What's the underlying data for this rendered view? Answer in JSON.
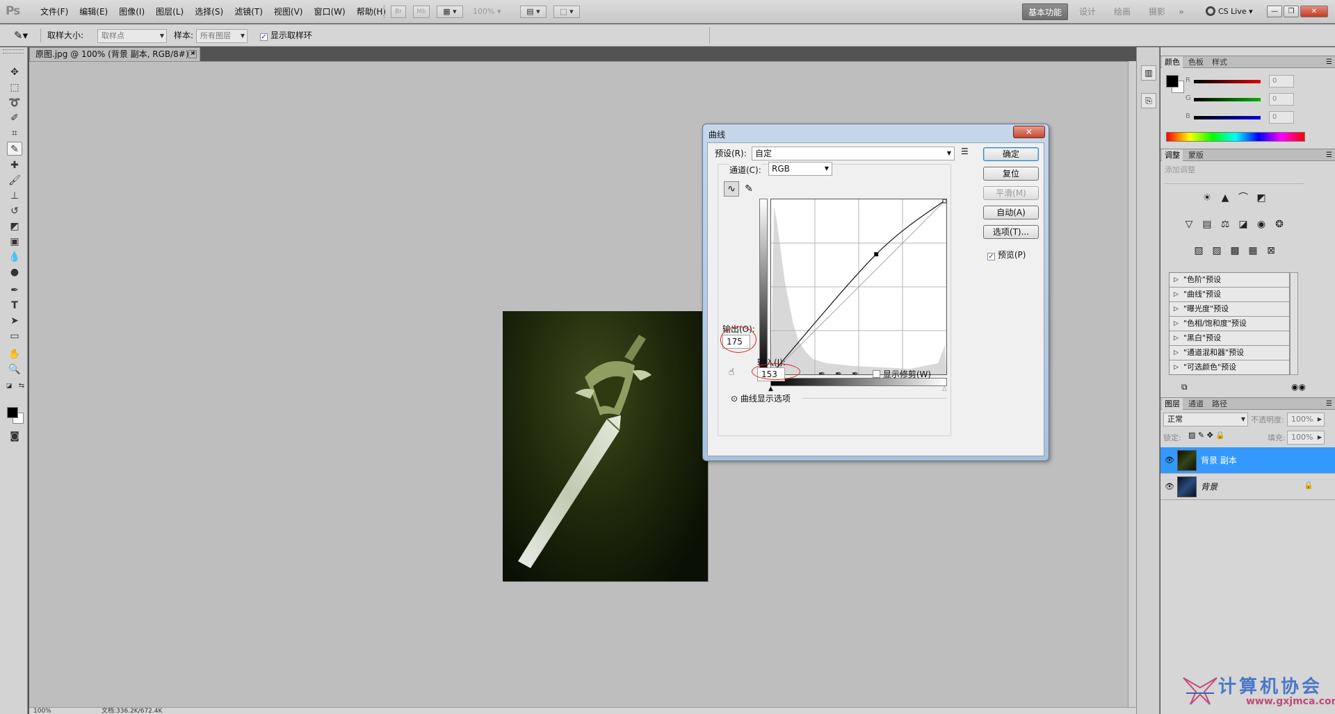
{
  "app": {
    "logo": "Ps"
  },
  "menu": [
    "文件(F)",
    "编辑(E)",
    "图像(I)",
    "图层(L)",
    "选择(S)",
    "滤镜(T)",
    "视图(V)",
    "窗口(W)",
    "帮助(H)"
  ],
  "menubar": {
    "br": "Br",
    "mb": "Mb",
    "zoom": "100%"
  },
  "workspaces": {
    "basic": "基本功能",
    "design": "设计",
    "paint": "绘画",
    "photo": "摄影",
    "more": "»"
  },
  "cs_live": "CS Live",
  "options": {
    "sample_size_label": "取样大小:",
    "sample_size_value": "取样点",
    "sample_label": "样本:",
    "sample_value": "所有图层",
    "show_ring_label": "显示取样环",
    "show_ring_checked": true
  },
  "document": {
    "tab_title": "原图.jpg @ 100% (背景 副本, RGB/8#) *",
    "status_zoom": "100%",
    "status_doc": "文档:336.2K/672.4K"
  },
  "dialog": {
    "title": "曲线",
    "preset_label": "预设(R):",
    "preset_value": "自定",
    "channel_label": "通道(C):",
    "channel_value": "RGB",
    "output_label": "输出(O):",
    "output_value": "175",
    "input_label": "输入(I):",
    "input_value": "153",
    "show_clipping": "显示修剪(W)",
    "curve_options": "曲线显示选项",
    "buttons": {
      "ok": "确定",
      "reset": "复位",
      "smooth": "平滑(M)",
      "auto": "自动(A)",
      "options": "选项(T)..."
    },
    "preview_label": "预览(P)",
    "preview_checked": true,
    "curve": {
      "points": [
        [
          0,
          0
        ],
        [
          153,
          175
        ],
        [
          255,
          255
        ]
      ]
    }
  },
  "panels": {
    "color_tabs": [
      "颜色",
      "色板",
      "样式"
    ],
    "rgb": [
      {
        "letter": "R",
        "value": "0",
        "color": "#e00000"
      },
      {
        "letter": "G",
        "value": "0",
        "color": "#00b000"
      },
      {
        "letter": "B",
        "value": "0",
        "color": "#0000e0"
      }
    ],
    "adjust_tabs": [
      "调整",
      "蒙版"
    ],
    "add_adjustment": "添加调整",
    "presets": [
      "\"色阶\"预设",
      "\"曲线\"预设",
      "\"曝光度\"预设",
      "\"色相/饱和度\"预设",
      "\"黑白\"预设",
      "\"通道混和器\"预设",
      "\"可选颜色\"预设"
    ],
    "layers_tabs": [
      "图层",
      "通道",
      "路径"
    ],
    "blend_mode": "正常",
    "opacity_label": "不透明度:",
    "opacity_value": "100%",
    "lock_label": "锁定:",
    "fill_label": "填充:",
    "fill_value": "100%",
    "layers": [
      {
        "name": "背景 副本",
        "selected": true
      },
      {
        "name": "背景",
        "selected": false,
        "locked": true
      }
    ]
  },
  "watermark": {
    "text": "计算机协会",
    "url": "www.gxjmca.com"
  },
  "colors": {
    "selection_blue": "#3399ff",
    "accent_red": "#e02020"
  }
}
